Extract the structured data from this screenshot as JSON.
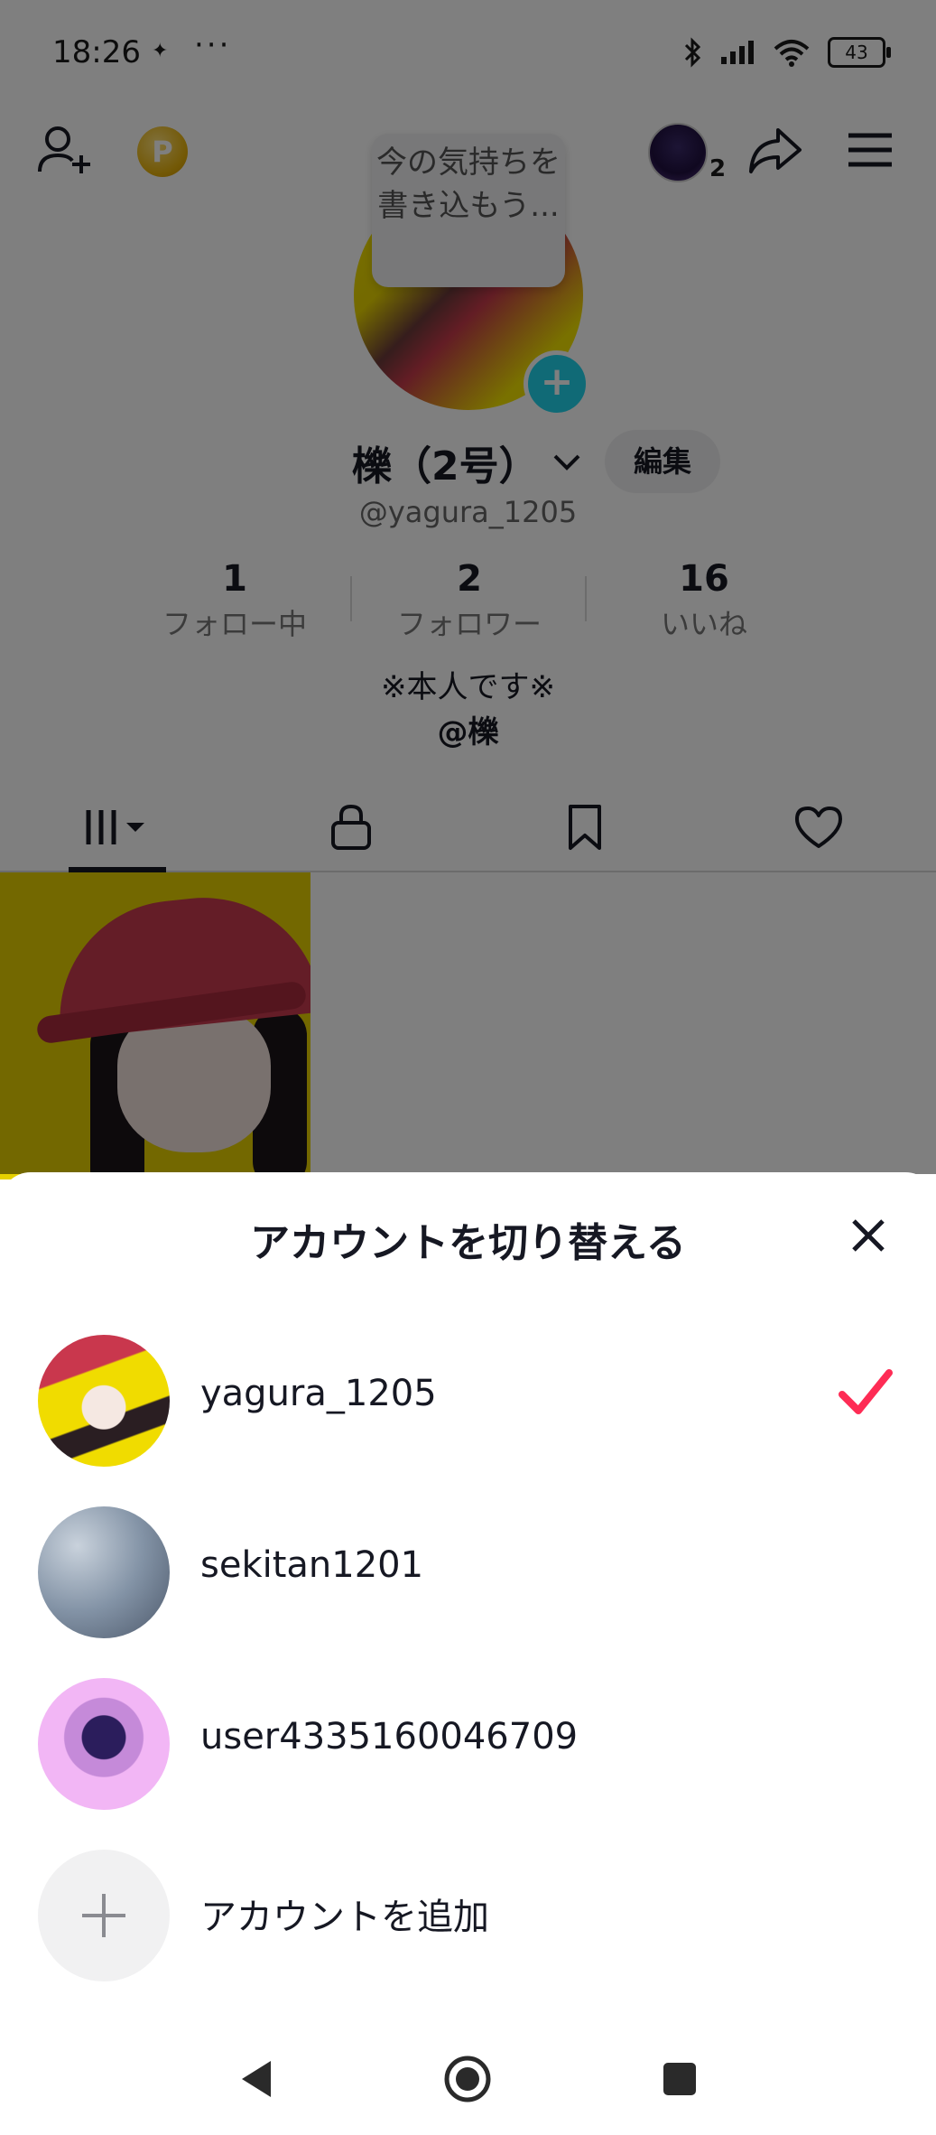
{
  "status_bar": {
    "time": "18:26",
    "dots": "···",
    "battery": "43"
  },
  "header": {
    "mini_account_count": "2"
  },
  "profile": {
    "note": "今の気持ちを書き込もう...",
    "name": "櫟（2号）",
    "edit_label": "編集",
    "handle": "@yagura_1205",
    "stats": [
      {
        "num": "1",
        "label": "フォロー中"
      },
      {
        "num": "2",
        "label": "フォロワー"
      },
      {
        "num": "16",
        "label": "いいね"
      }
    ],
    "bio_line1": "※本人です※",
    "bio_line2": "@櫟"
  },
  "tabs": [
    "videos-icon",
    "lock-icon",
    "bookmark-icon",
    "heart-icon"
  ],
  "sheet": {
    "title": "アカウントを切り替える",
    "accounts": [
      {
        "name": "yagura_1205",
        "selected": true
      },
      {
        "name": "sekitan1201",
        "selected": false
      },
      {
        "name": "user4335160046709",
        "selected": false
      }
    ],
    "add_label": "アカウントを追加"
  },
  "colors": {
    "check": "#fe2c55",
    "plus_badge": "#20d5ec",
    "coin": "#e7b20c"
  }
}
